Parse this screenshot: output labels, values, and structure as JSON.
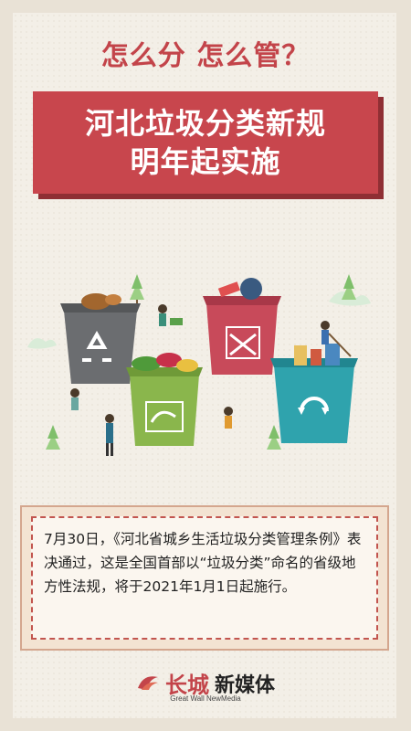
{
  "header": {
    "subtitle": "怎么分  怎么管？",
    "title_line1": "河北垃圾分类新规",
    "title_line2": "明年起实施"
  },
  "content": {
    "paragraph": "7月30日，《河北省城乡生活垃圾分类管理条例》表决通过，这是全国首部以“垃圾分类”命名的省级地方性法规，将于2021年1月1日起施行。"
  },
  "logo": {
    "brand_cn": "长城",
    "brand_cn2": "新媒体",
    "brand_en": "Great Wall NewMedia"
  },
  "colors": {
    "accent_red": "#c8464d",
    "bin_gray": "#6b6d70",
    "bin_green": "#8ab64c",
    "bin_red": "#c84a5a",
    "bin_teal": "#2fa3ad"
  }
}
